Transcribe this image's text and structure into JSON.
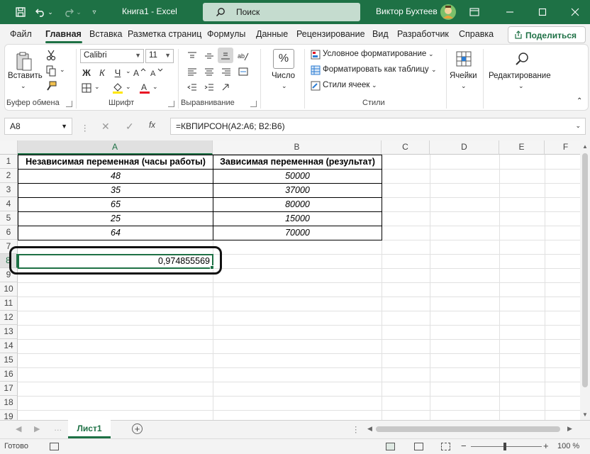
{
  "titlebar": {
    "title": "Книга1  -  Excel",
    "search_placeholder": "Поиск",
    "user": "Виктор Бухтеев"
  },
  "tabs": [
    "Файл",
    "Главная",
    "Вставка",
    "Разметка страниц",
    "Формулы",
    "Данные",
    "Рецензирование",
    "Вид",
    "Разработчик",
    "Справка"
  ],
  "share_label": "Поделиться",
  "ribbon": {
    "paste_label": "Вставить",
    "clipboard_label": "Буфер обмена",
    "font_name": "Calibri",
    "font_size": "11",
    "font_group_label": "Шрифт",
    "bold": "Ж",
    "italic": "К",
    "underline": "Ч",
    "align_group_label": "Выравнивание",
    "number_label": "Число",
    "percent": "%",
    "cond_format": "Условное форматирование",
    "format_table": "Форматировать как таблицу",
    "cell_styles": "Стили ячеек",
    "styles_group_label": "Стили",
    "cells_label": "Ячейки",
    "editing_label": "Редактирование"
  },
  "formula_bar": {
    "name_box": "A8",
    "fx": "fx",
    "formula": "=КВПИРСОН(A2:A6; B2:B6)"
  },
  "grid": {
    "columns": [
      "A",
      "B",
      "C",
      "D",
      "E",
      "F"
    ],
    "rows": [
      "1",
      "2",
      "3",
      "4",
      "5",
      "6",
      "7",
      "8",
      "9",
      "10",
      "11",
      "12",
      "13",
      "14",
      "15",
      "16",
      "17",
      "18",
      "19"
    ],
    "header_a": "Независимая переменная (часы работы)",
    "header_b": "Зависимая переменная (результат)",
    "col_a": [
      "48",
      "35",
      "65",
      "25",
      "64"
    ],
    "col_b": [
      "50000",
      "37000",
      "80000",
      "15000",
      "70000"
    ],
    "result": "0,974855569"
  },
  "sheet_tab": "Лист1",
  "status": {
    "ready": "Готово",
    "zoom": "100 %"
  },
  "colors": {
    "accent": "#1e7145"
  }
}
